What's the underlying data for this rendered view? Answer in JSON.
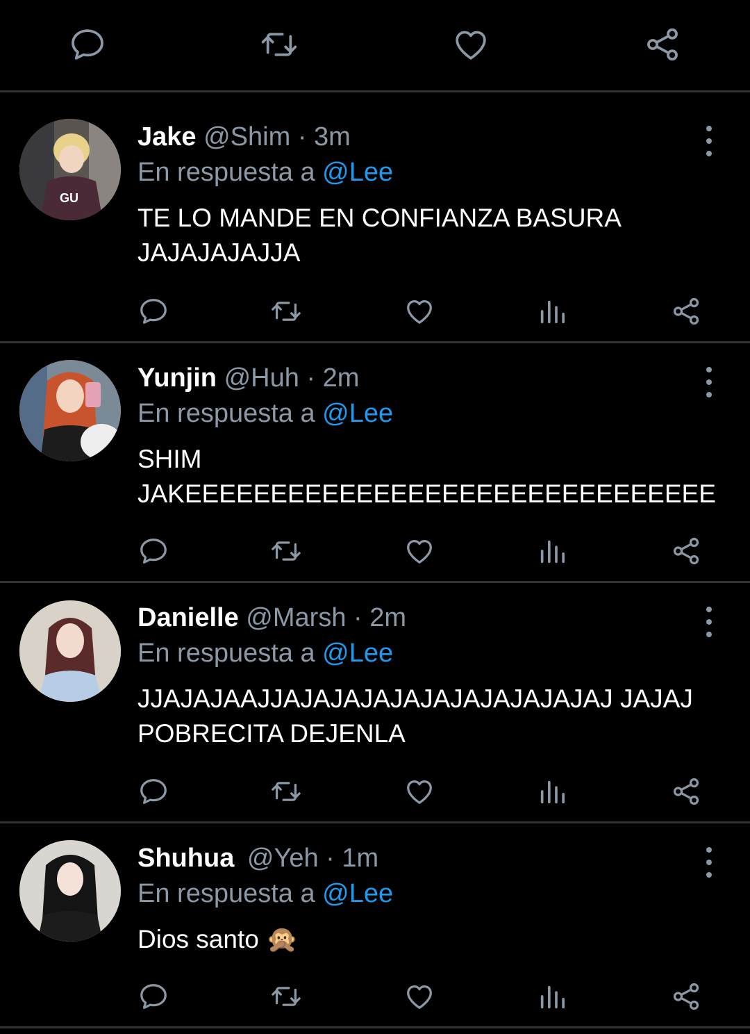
{
  "colors": {
    "background": "#000000",
    "divider": "#2f3336",
    "muted": "#8b98a5",
    "mention": "#1d9bf0",
    "text": "#ffffff"
  },
  "top_actions": [
    "reply-icon",
    "retweet-icon",
    "like-icon",
    "share-icon"
  ],
  "tweets": [
    {
      "name": "Jake",
      "handle": "@Shim",
      "separator": "·",
      "time": "3m",
      "reply_prefix": "En respuesta a",
      "reply_to": "@Lee",
      "body": "TE LO MANDE EN CONFIANZA BASURA JAJAJAJAJJA",
      "avatar_color": "#b39a7c"
    },
    {
      "name": "Yunjin",
      "handle": "@Huh",
      "separator": "·",
      "time": "2m",
      "reply_prefix": "En respuesta a",
      "reply_to": "@Lee",
      "body": "SHIM JAKEEEEEEEEEEEEEEEEEEEEEEEEEEEEEEE",
      "avatar_color": "#c26a4a"
    },
    {
      "name": "Danielle",
      "handle": "@Marsh",
      "separator": "·",
      "time": "2m",
      "reply_prefix": "En respuesta a",
      "reply_to": "@Lee",
      "body": "JJAJAJAAJJAJAJAJAJAJAJAJAJAJAJAJ JAJAJ POBRECITA DEJENLA",
      "avatar_color": "#d6d0c4"
    },
    {
      "name": "Shuhua",
      "handle": "@Yeh",
      "separator": "·",
      "time": "1m",
      "reply_prefix": "En respuesta a",
      "reply_to": "@Lee",
      "body": "Dios santo 🙊",
      "avatar_color": "#6a6a6a"
    }
  ]
}
